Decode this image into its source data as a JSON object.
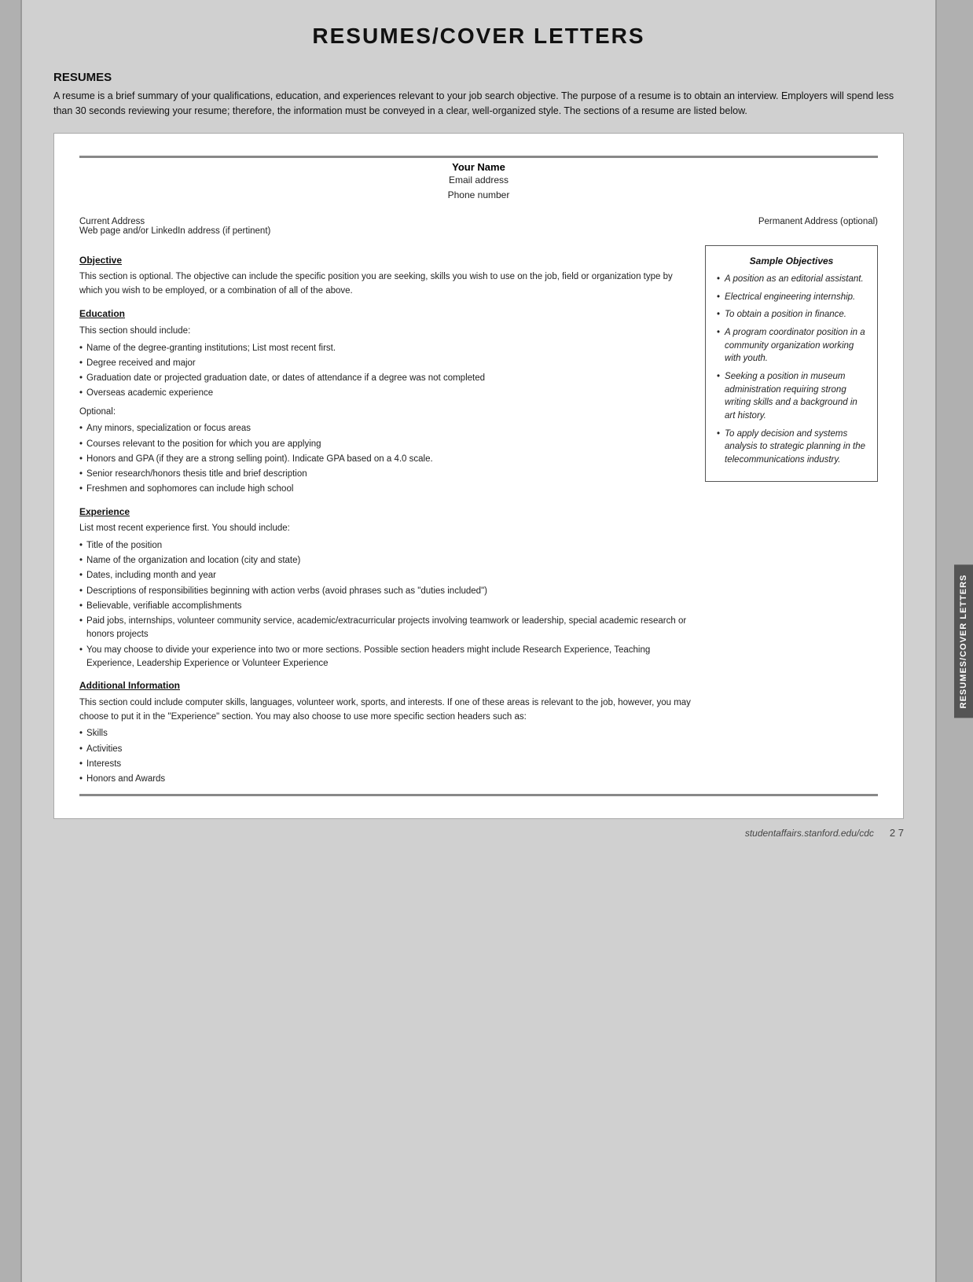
{
  "page": {
    "title": "RESUMES/COVER LETTERS",
    "section_heading": "RESUMES",
    "intro": "A resume is a brief summary of your qualifications, education, and experiences relevant to your job search objective. The purpose of a resume is to obtain an interview. Employers will spend less than 30 seconds reviewing your resume; therefore, the information must be conveyed in a clear, well-organized style. The sections of a resume are listed below."
  },
  "resume_template": {
    "name": "Your Name",
    "email": "Email address",
    "phone": "Phone number",
    "current_address": "Current Address",
    "web_address": "Web page and/or LinkedIn address (if pertinent)",
    "permanent_address": "Permanent Address (optional)",
    "objective_title": "Objective",
    "objective_text": "This section is optional. The objective can include the specific position you are seeking, skills you wish to use on the job, field or organization type by which you wish to be employed, or a combination of all of the above.",
    "education_title": "Education",
    "education_intro": "This section should include:",
    "education_bullets": [
      "Name of the degree-granting institutions; List most recent first.",
      "Degree received and major",
      "Graduation date or projected graduation date, or dates of attendance if a degree was not completed",
      "Overseas academic experience"
    ],
    "optional_label": "Optional:",
    "optional_bullets": [
      "Any minors, specialization or focus areas",
      "Courses relevant to the position for which you are applying",
      "Honors and GPA (if they are a strong selling point). Indicate GPA based on a 4.0 scale.",
      "Senior research/honors thesis title and brief description",
      "Freshmen and sophomores can include high school"
    ],
    "experience_title": "Experience",
    "experience_intro": "List most recent experience first. You should include:",
    "experience_bullets": [
      "Title of the position",
      "Name of the organization and location (city and state)",
      "Dates, including month and year",
      "Descriptions of responsibilities beginning with action verbs (avoid phrases such as \"duties included\")",
      "Believable, verifiable accomplishments",
      "Paid jobs, internships, volunteer community service, academic/extracurricular projects involving teamwork or leadership, special academic research or honors projects",
      "You may choose to divide your experience into two or more sections. Possible section headers might include Research Experience, Teaching Experience, Leadership Experience or Volunteer Experience"
    ],
    "additional_title": "Additional Information",
    "additional_text": "This section could include computer skills, languages, volunteer work, sports, and interests. If one of these areas is relevant to the job, however, you may choose to put it in the \"Experience\" section. You may also choose to use more specific section headers such as:",
    "additional_bullets": [
      "Skills",
      "Activities",
      "Interests",
      "Honors and Awards"
    ]
  },
  "sample_objectives": {
    "title": "Sample Objectives",
    "items": [
      "A position as an editorial assistant.",
      "Electrical engineering internship.",
      "To obtain a position in finance.",
      "A program coordinator position in a community organization working with youth.",
      "Seeking a position in museum administration requiring strong writing skills and a background in art history.",
      "To apply decision and systems analysis to strategic planning in the telecommunications industry."
    ]
  },
  "footer": {
    "url": "studentaffairs.stanford.edu/cdc",
    "page": "2 7"
  },
  "sidebar_label": "RESUMES/COVER LETTERS"
}
